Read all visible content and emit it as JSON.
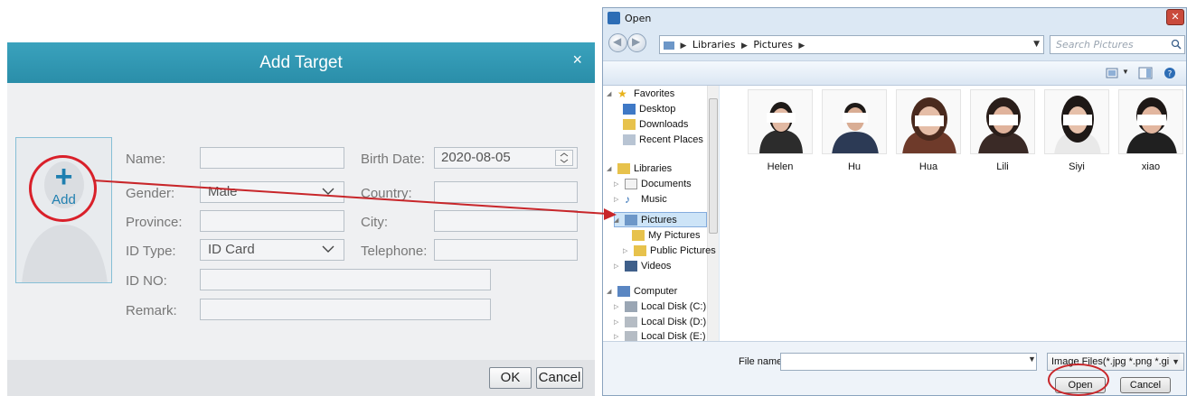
{
  "add_target": {
    "title": "Add Target",
    "close": "×",
    "photo": {
      "plus": "+",
      "label": "Add"
    },
    "labels": {
      "name": "Name:",
      "gender": "Gender:",
      "province": "Province:",
      "id_type": "ID Type:",
      "id_no": "ID NO:",
      "remark": "Remark:",
      "birth_date": "Birth Date:",
      "country": "Country:",
      "city": "City:",
      "telephone": "Telephone:"
    },
    "values": {
      "name": "",
      "gender": "Male",
      "province": "",
      "id_type": "ID Card",
      "id_no": "",
      "remark": "",
      "birth_date": "2020-08-05",
      "country": "",
      "city": "",
      "telephone": ""
    },
    "buttons": {
      "ok": "OK",
      "cancel": "Cancel"
    }
  },
  "open_dialog": {
    "title": "Open",
    "close": "✕",
    "breadcrumb": [
      "Libraries",
      "Pictures"
    ],
    "search_placeholder": "Search Pictures",
    "nav": {
      "favorites": "Favorites",
      "desktop": "Desktop",
      "downloads": "Downloads",
      "recent": "Recent Places",
      "libraries": "Libraries",
      "documents": "Documents",
      "music": "Music",
      "pictures": "Pictures",
      "my_pictures": "My Pictures",
      "public_pictures": "Public Pictures",
      "videos": "Videos",
      "computer": "Computer",
      "disk_c": "Local Disk (C:)",
      "disk_d": "Local Disk (D:)",
      "disk_e": "Local Disk (E:)"
    },
    "files": [
      {
        "name": "Helen"
      },
      {
        "name": "Hu"
      },
      {
        "name": "Hua"
      },
      {
        "name": "Lili"
      },
      {
        "name": "Siyi"
      },
      {
        "name": "xiao"
      }
    ],
    "file_name_label": "File name:",
    "file_name_value": "",
    "file_type": "Image Files(*.jpg *.png *.gif)",
    "buttons": {
      "open": "Open",
      "cancel": "Cancel"
    }
  },
  "colors": {
    "title_bar": "#2f97b2",
    "annotation_red": "#d9202a",
    "add_blue": "#1f7fb0"
  }
}
